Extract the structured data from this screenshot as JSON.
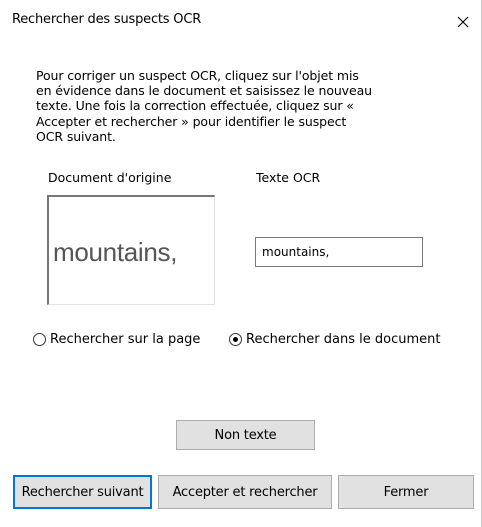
{
  "window": {
    "title": "Rechercher des suspects OCR"
  },
  "instructions": "Pour corriger un suspect OCR, cliquez sur l'objet mis\nen évidence dans le document et saisissez le nouveau\ntexte. Une fois la correction effectuée, cliquez sur «\nAccepter et rechercher » pour identifier le suspect\nOCR suivant.",
  "labels": {
    "original_document": "Document d'origine",
    "ocr_text": "Texte OCR"
  },
  "preview": {
    "word": "mountains,"
  },
  "ocr_field": {
    "value": "mountains,"
  },
  "scope": {
    "options": [
      {
        "label": "Rechercher sur la page",
        "selected": false
      },
      {
        "label": "Rechercher dans le document",
        "selected": true
      }
    ]
  },
  "buttons": {
    "not_text": "Non texte",
    "find_next": "Rechercher suivant",
    "accept_and_find": "Accepter et rechercher",
    "close": "Fermer"
  },
  "icons": {
    "close": "close-icon"
  }
}
